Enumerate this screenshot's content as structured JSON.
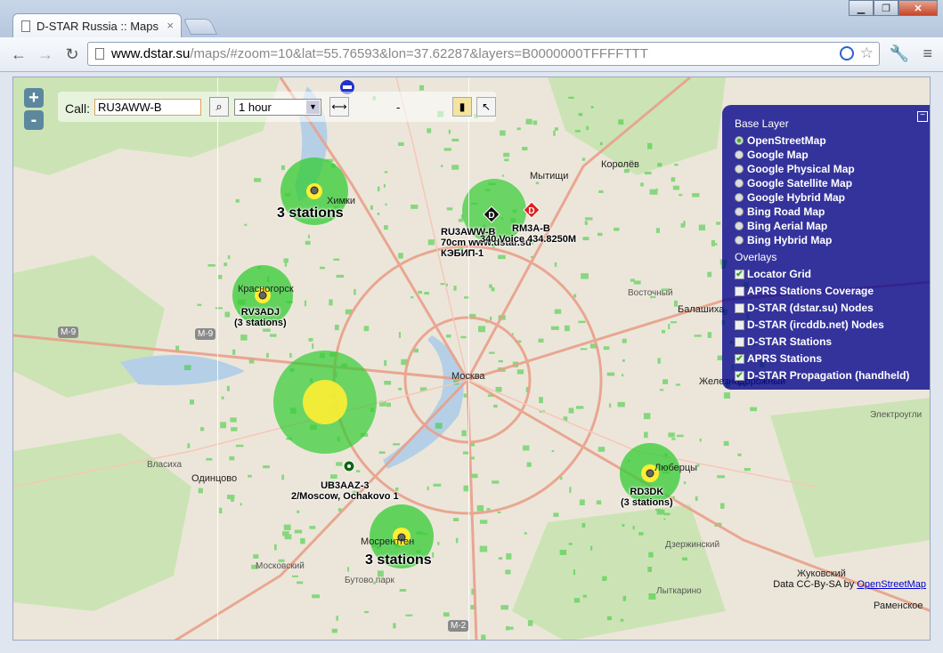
{
  "window": {
    "tab_title": "D-STAR Russia :: Maps",
    "tab_close": "×",
    "btn_minimize": "▁",
    "btn_maximize": "❐",
    "btn_close": "✕"
  },
  "toolbar": {
    "back": "←",
    "forward": "→",
    "reload": "↻",
    "url_host": "www.dstar.su",
    "url_path": "/maps/#zoom=10&lat=55.76593&lon=37.62287&layers=B0000000TFFFFTTT",
    "star": "☆",
    "wrench": "🔧",
    "menu": "≡"
  },
  "map": {
    "zoom_in": "+",
    "zoom_out": "-",
    "call_label": "Call:",
    "call_value": "RU3AWW-B",
    "search_glyph": "⌕",
    "period": "1 hour",
    "period_arrow": "▼",
    "dash": "-",
    "attribution_prefix": "Data CC-By-SA by ",
    "attribution_link": "OpenStreetMap",
    "layers": {
      "minimize": "−",
      "base_header": "Base Layer",
      "base": [
        "OpenStreetMap",
        "Google Map",
        "Google Physical Map",
        "Google Satellite Map",
        "Google Hybrid Map",
        "Bing Road Map",
        "Bing Aerial Map",
        "Bing Hybrid Map"
      ],
      "overlays_header": "Overlays",
      "overlays": [
        {
          "label": "Locator Grid",
          "checked": true
        },
        {
          "label": "APRS Stations Coverage",
          "checked": false
        },
        {
          "label": "D-STAR (dstar.su) Nodes",
          "checked": false
        },
        {
          "label": "D-STAR (ircddb.net) Nodes",
          "checked": false
        },
        {
          "label": "D-STAR Stations",
          "checked": false
        },
        {
          "label": "APRS Stations",
          "checked": true
        },
        {
          "label": "D-STAR Propagation (handheld)",
          "checked": true
        }
      ]
    },
    "labels": {
      "himki_group": "3 stations",
      "south_group": "3 stations",
      "rv3adj_call": "RV3ADJ",
      "rv3adj_count": "(3 stations)",
      "rd3dk_call": "RD3DK",
      "rd3dk_count": "(3 stations)",
      "ub3aaz_call": "UB3AAZ-3",
      "ub3aaz_desc": "2/Moscow, Ochakovo 1",
      "ru3aww_call": "RU3AWW-B",
      "ru3aww_desc": "70cm www.dstar.su",
      "ru3aww_extra": "КЭБИП-1",
      "rm3a_call": "RM3A-B",
      "rm3a_desc": "340 Voice 434.8250M"
    },
    "places": {
      "himki": "Химки",
      "krasnogorsk": "Красногорск",
      "moskva": "Москва",
      "mytishchi": "Мытищи",
      "korolev": "Королёв",
      "balashikha": "Балашиха",
      "odintsovo": "Одинцово",
      "mosrentgen": "Мосрентген",
      "zhukovsky": "Жуковский",
      "ramenskoe": "Раменское",
      "lyubertsy": "Люберцы",
      "zheleznodorozhny": "Железнодорожный",
      "vostochny": "Восточный",
      "elektrougli": "Электроугли",
      "dzerzhinsky": "Дзержинский",
      "vlasikha": "Власиха",
      "lytkarino": "Лыткарино",
      "moskovsky": "Московский",
      "butovo": "Бутово парк"
    },
    "road_labels": [
      "M-9",
      "M-9",
      "M-2"
    ],
    "colors": {
      "coverage_green": "#33cc33",
      "coverage_yellow": "#ffee33",
      "layer_panel": "#00008b",
      "repeater_red": "#e02020"
    }
  }
}
